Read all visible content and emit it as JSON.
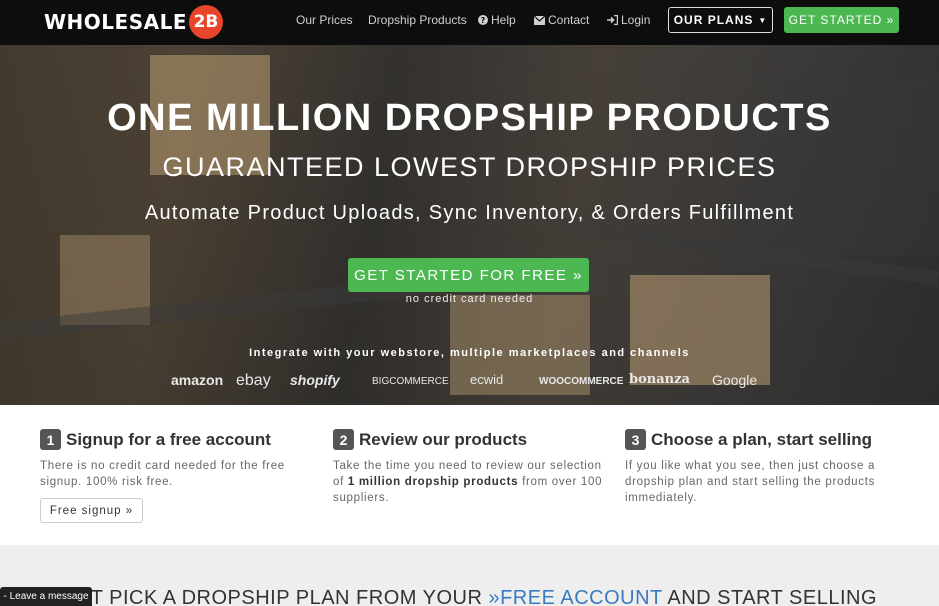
{
  "nav": {
    "logo_text": "WHOLESALE",
    "logo_badge": "2B",
    "links": [
      {
        "label": "Our Prices",
        "icon": ""
      },
      {
        "label": "Dropship Products",
        "icon": ""
      },
      {
        "label": "Help",
        "icon": "help-circle-icon"
      },
      {
        "label": "Contact",
        "icon": "envelope-icon"
      },
      {
        "label": "Login",
        "icon": "login-icon"
      }
    ],
    "plans_label": "OUR PLANS",
    "get_started_label": "GET STARTED »"
  },
  "hero": {
    "title": "ONE MILLION DROPSHIP PRODUCTS",
    "subtitle": "GUARANTEED LOWEST DROPSHIP PRICES",
    "tagline": "Automate Product Uploads, Sync Inventory, & Orders Fulfillment",
    "cta_label": "GET STARTED FOR FREE »",
    "cta_note": "no credit card needed",
    "integrate_text": "Integrate with your webstore, multiple marketplaces and channels",
    "marketplaces": [
      "amazon",
      "ebay",
      "shopify",
      "BIGCOMMERCE",
      "ecwid",
      "WOOCOMMERCE",
      "bonanza",
      "Google"
    ]
  },
  "steps": [
    {
      "num": "1",
      "title": "Signup for a free account",
      "desc": "There is no credit card needed for the free signup. 100% risk free.",
      "button": "Free signup »"
    },
    {
      "num": "2",
      "title": "Review our products",
      "desc_pre": "Take the time you need to review our selection of ",
      "desc_bold": "1 million dropship products",
      "desc_post": " from over 100 suppliers."
    },
    {
      "num": "3",
      "title": "Choose a plan, start selling",
      "desc": "If you like what you see, then just choose a dropship plan and start selling the products immediately."
    }
  ],
  "bottom": {
    "pre": "UST PICK A DROPSHIP PLAN FROM YOUR ",
    "link": "»FREE ACCOUNT",
    "post": " AND START SELLING"
  },
  "chat": {
    "label": "Leave a message"
  },
  "colors": {
    "green": "#4cb851",
    "logo_red": "#e8462b",
    "link_blue": "#3a7abf",
    "navbar": "#0d0d0d"
  }
}
